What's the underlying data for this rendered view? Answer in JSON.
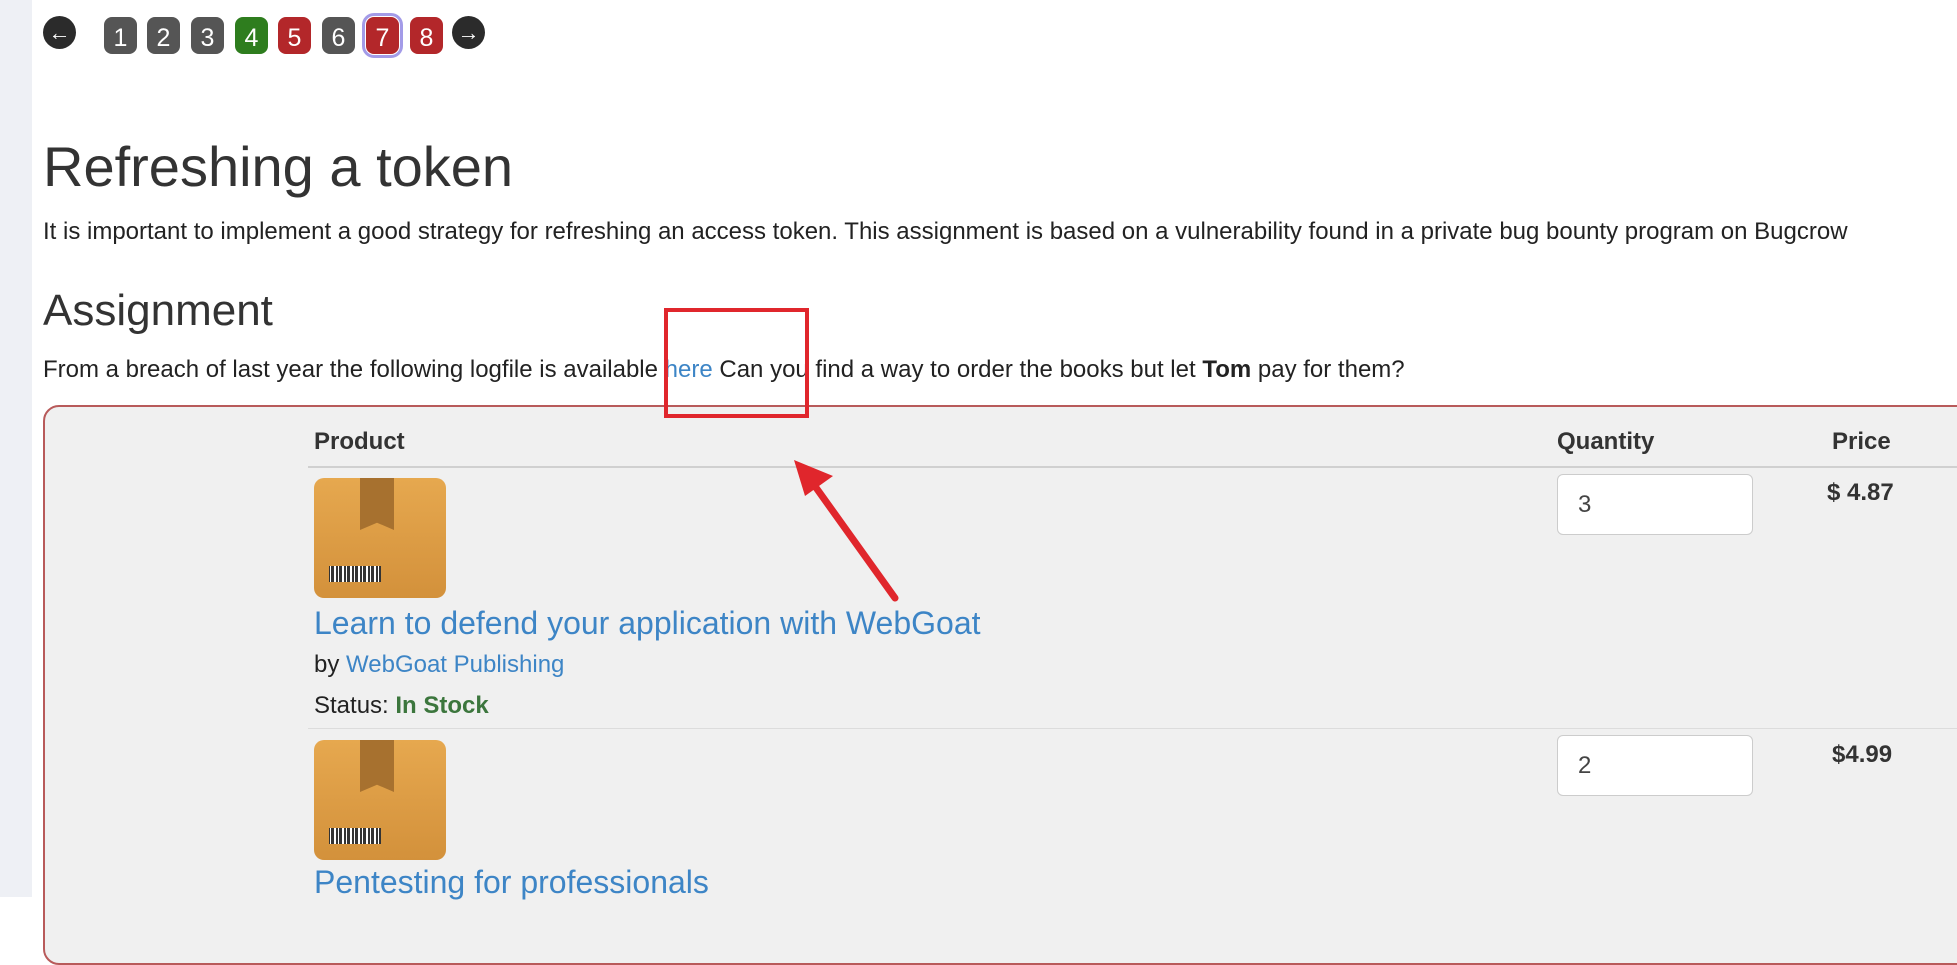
{
  "pagination": {
    "prev_icon": "arrow-left-icon",
    "next_icon": "arrow-right-icon",
    "pages": [
      {
        "label": "1",
        "color": "#555555"
      },
      {
        "label": "2",
        "color": "#555555"
      },
      {
        "label": "3",
        "color": "#555555"
      },
      {
        "label": "4",
        "color": "#2e7d1e"
      },
      {
        "label": "5",
        "color": "#b3272a"
      },
      {
        "label": "6",
        "color": "#555555"
      },
      {
        "label": "7",
        "color": "#b3272a",
        "current": true
      },
      {
        "label": "8",
        "color": "#b3272a"
      }
    ]
  },
  "lesson": {
    "title": "Refreshing a token",
    "intro": "It is important to implement a good strategy for refreshing an access token. This assignment is based on a vulnerability found in a private bug bounty program on Bugcrow",
    "assignment_title": "Assignment",
    "assignment_text_1": "From a breach of last year the following logfile is available ",
    "here_link": "here",
    "assignment_text_2": " Can you find a way to order the books but let ",
    "tom": "Tom",
    "assignment_text_3": " pay for them?"
  },
  "annotation": {
    "color": "#e0262c"
  },
  "cart": {
    "headers": {
      "product": "Product",
      "quantity": "Quantity",
      "price": "Price"
    },
    "items": [
      {
        "name": "Learn to defend your application with WebGoat",
        "by": "by",
        "publisher": "WebGoat Publishing",
        "status_label": "Status:",
        "status": "In Stock",
        "quantity": "3",
        "price": "$ 4.87",
        "image_icon": "package-box-icon"
      },
      {
        "name": "Pentesting for professionals",
        "quantity": "2",
        "price": "$4.99",
        "image_icon": "package-box-icon"
      }
    ]
  }
}
